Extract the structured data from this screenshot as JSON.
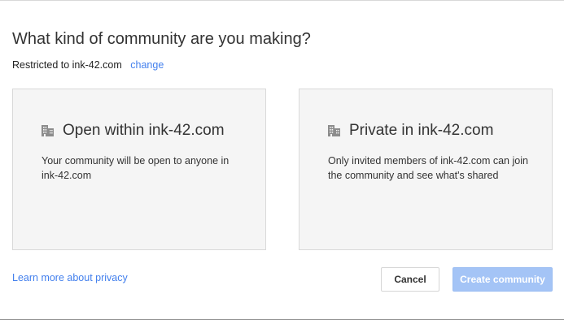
{
  "dialog": {
    "title": "What kind of community are you making?",
    "restriction_text": "Restricted to ink-42.com",
    "change_link": "change"
  },
  "options": [
    {
      "icon": "building-icon",
      "title": "Open within ink-42.com",
      "description": "Your community will be open to anyone in ink-42.com"
    },
    {
      "icon": "building-icon",
      "title": "Private in ink-42.com",
      "description": "Only invited members of ink-42.com can join the community and see what's shared"
    }
  ],
  "footer": {
    "learn_more": "Learn more about privacy",
    "cancel_label": "Cancel",
    "create_label": "Create community"
  },
  "colors": {
    "link": "#427fed",
    "card_background": "#f5f5f5",
    "create_button_disabled": "#a4c4f6"
  }
}
